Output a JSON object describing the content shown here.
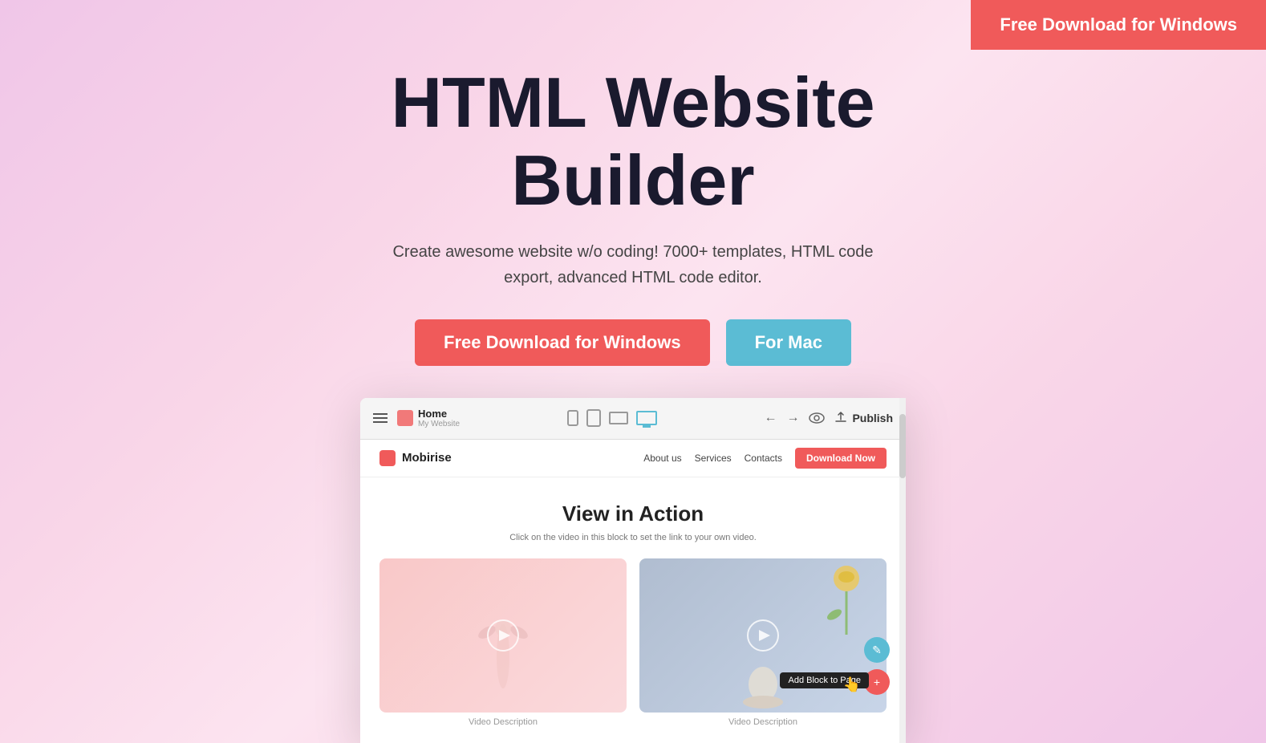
{
  "top_button": {
    "label": "Free Download for Windows"
  },
  "hero": {
    "title_line1": "HTML Website",
    "title_line2": "Builder",
    "subtitle": "Create awesome website w/o coding! 7000+ templates, HTML code export, advanced HTML code editor.",
    "btn_windows": "Free Download for Windows",
    "btn_mac": "For Mac"
  },
  "mockup": {
    "toolbar": {
      "home_label": "Home",
      "home_sublabel": "My Website",
      "back_icon": "←",
      "forward_icon": "→",
      "preview_icon": "👁",
      "publish_icon": "☁",
      "publish_label": "Publish"
    },
    "site": {
      "logo_name": "Mobirise",
      "nav_links": [
        "About us",
        "Services",
        "Contacts"
      ],
      "download_btn": "Download Now",
      "section_title": "View in Action",
      "section_desc": "Click on the video in this block to set the link to your own video.",
      "video1_desc": "Video Description",
      "video2_desc": "Video Description",
      "add_block_label": "Add Block to Page"
    },
    "colors": {
      "accent": "#f05a5a",
      "teal": "#5bbcd4"
    }
  }
}
